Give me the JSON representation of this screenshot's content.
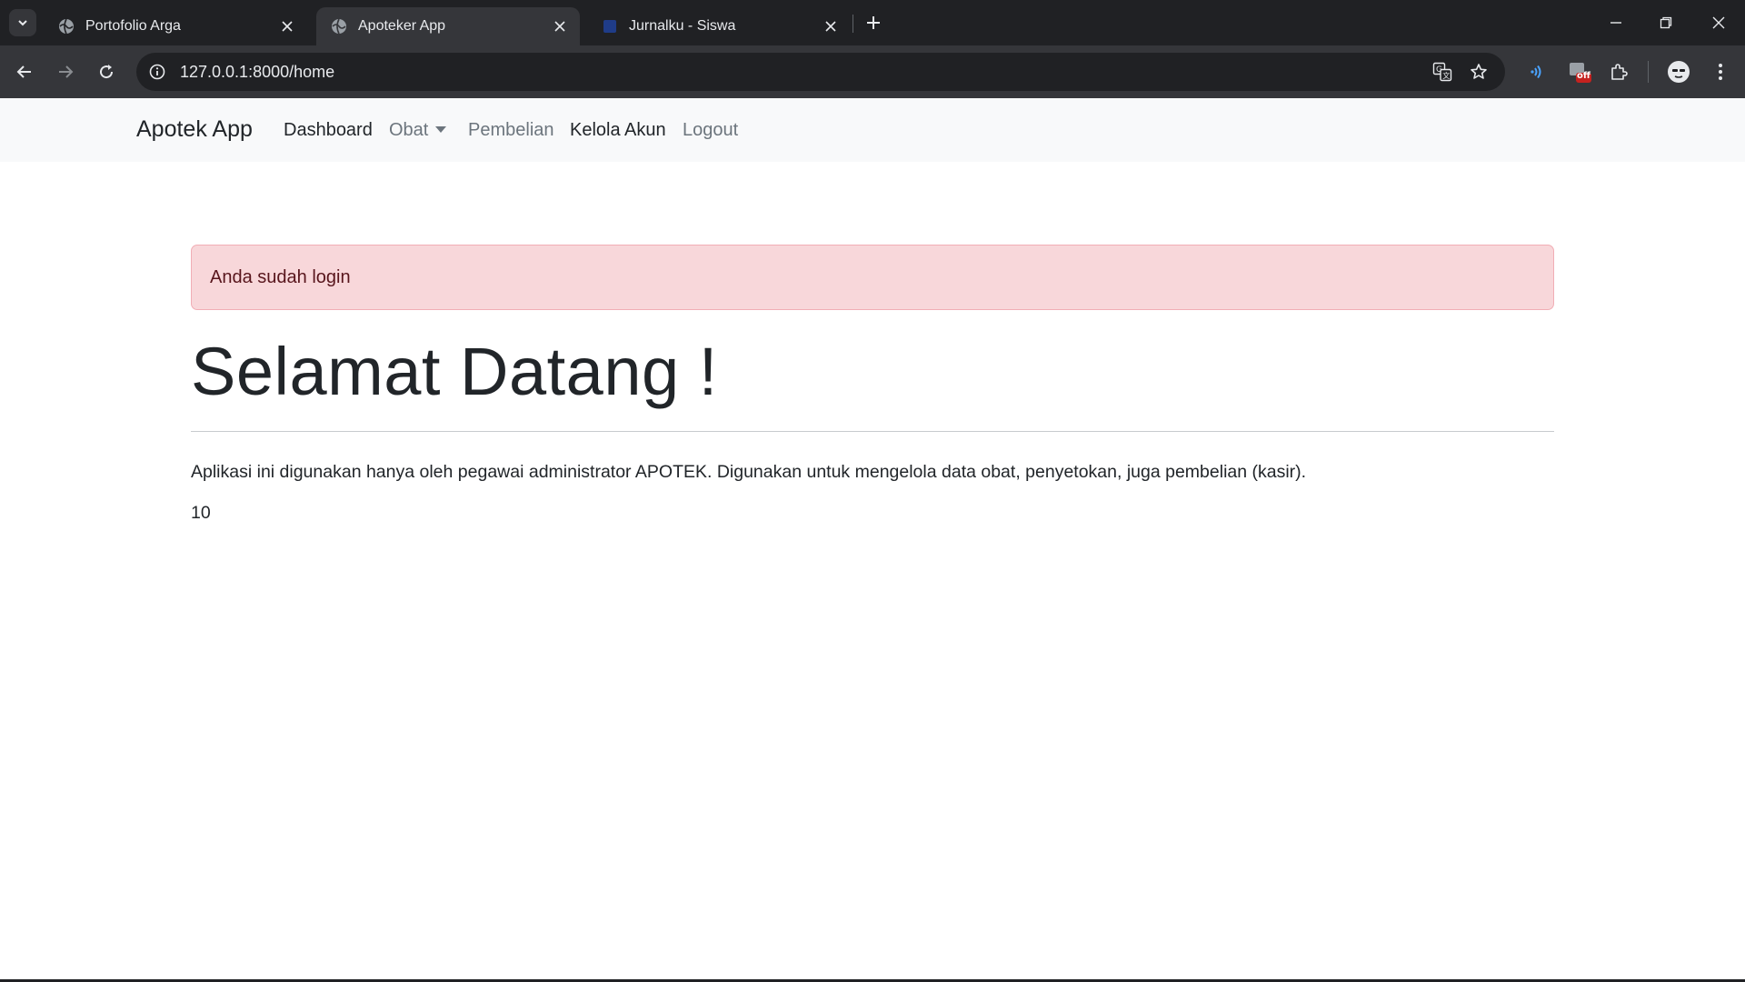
{
  "browser": {
    "tabs": [
      {
        "title": "Portofolio Arga",
        "favicon": "globe-icon",
        "active": false
      },
      {
        "title": "Apoteker App",
        "favicon": "globe-icon",
        "active": true
      },
      {
        "title": "Jurnalku - Siswa",
        "favicon": "blue-square-icon",
        "active": false
      }
    ],
    "url": "127.0.0.1:8000/home",
    "extension_badge": "off"
  },
  "navbar": {
    "brand": "Apotek App",
    "links": [
      {
        "label": "Dashboard",
        "state": "dark"
      },
      {
        "label": "Obat",
        "state": "muted",
        "dropdown": true
      },
      {
        "label": "Pembelian",
        "state": "muted"
      },
      {
        "label": "Kelola Akun",
        "state": "dark"
      },
      {
        "label": "Logout",
        "state": "muted"
      }
    ]
  },
  "main": {
    "alert": "Anda sudah login",
    "heading": "Selamat Datang !",
    "description": "Aplikasi ini digunakan hanya oleh pegawai administrator APOTEK. Digunakan untuk mengelola data obat, penyetokan, juga pembelian (kasir).",
    "count": "10"
  },
  "colors": {
    "navbar_bg": "#f8f9fa",
    "alert_bg": "#f8d7da",
    "alert_text": "#58151c",
    "chrome_dark": "#202124",
    "chrome_toolbar": "#35363a"
  }
}
